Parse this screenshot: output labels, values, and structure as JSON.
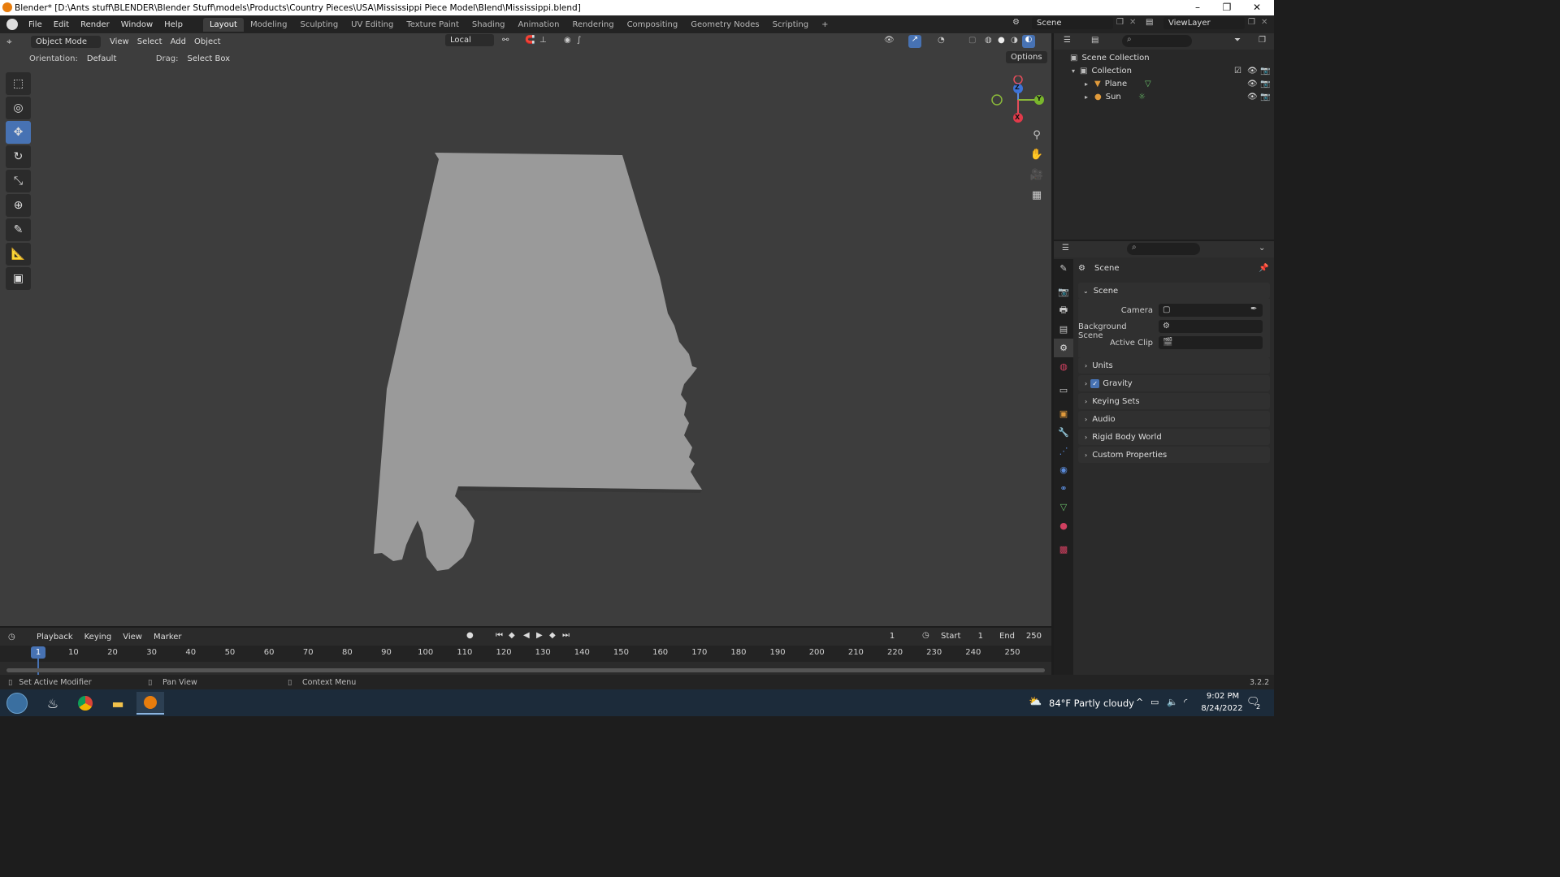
{
  "window": {
    "title": "Blender* [D:\\Ants stuff\\BLENDER\\Blender Stuff\\models\\Products\\Country Pieces\\USA\\Mississippi Piece Model\\Blend\\Mississippi.blend]",
    "minimize": "–",
    "maximize": "❐",
    "close": "✕"
  },
  "menu": [
    "File",
    "Edit",
    "Render",
    "Window",
    "Help"
  ],
  "workspaces": [
    "Layout",
    "Modeling",
    "Sculpting",
    "UV Editing",
    "Texture Paint",
    "Shading",
    "Animation",
    "Rendering",
    "Compositing",
    "Geometry Nodes",
    "Scripting",
    "+"
  ],
  "scene_selector": "Scene",
  "viewlayer_selector": "ViewLayer",
  "viewport": {
    "mode": "Object Mode",
    "menus": [
      "View",
      "Select",
      "Add",
      "Object"
    ],
    "transform": "Local",
    "orientation_label": "Orientation:",
    "orientation_value": "Default",
    "drag_label": "Drag:",
    "drag_value": "Select Box",
    "options": "Options",
    "gizmo": {
      "z": "Z",
      "y": "Y",
      "x": "X"
    },
    "shape_color": "#9a9a9a",
    "bg_color": "#3d3d3d"
  },
  "outliner": {
    "root": "Scene Collection",
    "collection": "Collection",
    "items": [
      "Plane",
      "Sun"
    ]
  },
  "properties": {
    "header": "Scene",
    "panel_title": "Scene",
    "camera_label": "Camera",
    "background_scene_label": "Background Scene",
    "active_clip_label": "Active Clip",
    "sections": [
      "Units",
      "Gravity",
      "Keying Sets",
      "Audio",
      "Rigid Body World",
      "Custom Properties"
    ],
    "gravity_checked": true
  },
  "timeline": {
    "menus": [
      "Playback",
      "Keying",
      "View",
      "Marker"
    ],
    "current_frame": "1",
    "start_label": "Start",
    "start_value": "1",
    "end_label": "End",
    "end_value": "250",
    "ticks": [
      "1",
      "10",
      "20",
      "30",
      "40",
      "50",
      "60",
      "70",
      "80",
      "90",
      "100",
      "110",
      "120",
      "130",
      "140",
      "150",
      "160",
      "170",
      "180",
      "190",
      "200",
      "210",
      "220",
      "230",
      "240",
      "250"
    ]
  },
  "statusbar": {
    "left": "Set Active Modifier",
    "middle": "Pan View",
    "right": "Context Menu",
    "version": "3.2.2"
  },
  "taskbar": {
    "weather": "84°F  Partly cloudy",
    "time": "9:02 PM",
    "date": "8/24/2022",
    "notifications": "2"
  }
}
